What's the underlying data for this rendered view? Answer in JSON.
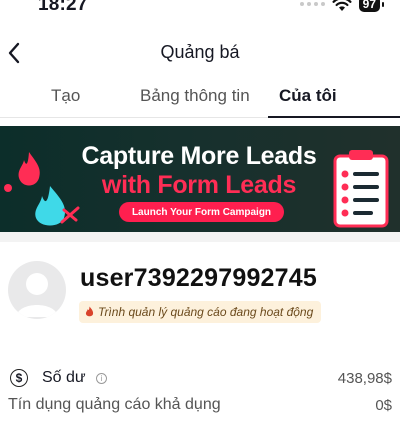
{
  "status_bar": {
    "time": "18:27",
    "battery": "97"
  },
  "header": {
    "title": "Quảng bá"
  },
  "tabs": [
    {
      "label": "Tạo"
    },
    {
      "label": "Bảng thông tin"
    },
    {
      "label": "Của tôi"
    }
  ],
  "banner": {
    "line1": "Capture More Leads",
    "line2": "with Form Leads",
    "cta": "Launch Your Form Campaign"
  },
  "profile": {
    "username": "user7392297992745",
    "status": "Trình quản lý quảng cáo đang hoạt động"
  },
  "balance": {
    "label": "Số dư",
    "value": "438,98$"
  },
  "ad_credit": {
    "label": "Tín dụng quảng cáo khả dụng",
    "value": "0$"
  },
  "colors": {
    "accent": "#ff2d55",
    "banner_bg": "#16302d",
    "badge_bg": "#fdf1dc"
  },
  "icons": [
    "wifi-icon",
    "battery-icon",
    "back-chevron-icon",
    "flame-icon",
    "dollar-icon",
    "info-icon",
    "checklist-icon"
  ]
}
